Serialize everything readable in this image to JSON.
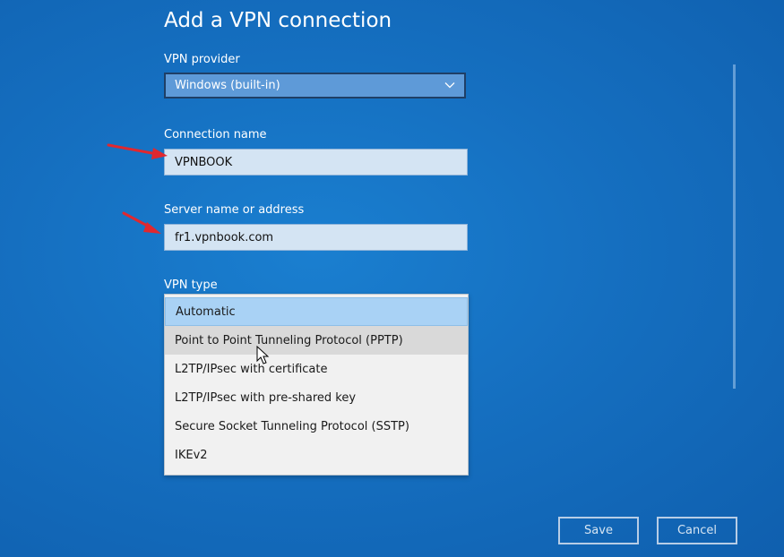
{
  "page": {
    "title": "Add a VPN connection"
  },
  "vpn_provider": {
    "label": "VPN provider",
    "value": "Windows (built-in)",
    "icon": "chevron-down-icon"
  },
  "connection_name": {
    "label": "Connection name",
    "value": "VPNBOOK"
  },
  "server": {
    "label": "Server name or address",
    "value": "fr1.vpnbook.com"
  },
  "vpn_type": {
    "label": "VPN type",
    "options": [
      "Automatic",
      "Point to Point Tunneling Protocol (PPTP)",
      "L2TP/IPsec with certificate",
      "L2TP/IPsec with pre-shared key",
      "Secure Socket Tunneling Protocol (SSTP)",
      "IKEv2"
    ],
    "selected": "Automatic",
    "hovered": "Point to Point Tunneling Protocol (PPTP)"
  },
  "buttons": {
    "save": "Save",
    "cancel": "Cancel"
  },
  "colors": {
    "background": "#156fc0",
    "annotation_arrow": "#e0282f",
    "selected_option": "#a9d2f5",
    "hovered_option": "#d9d9d9"
  }
}
